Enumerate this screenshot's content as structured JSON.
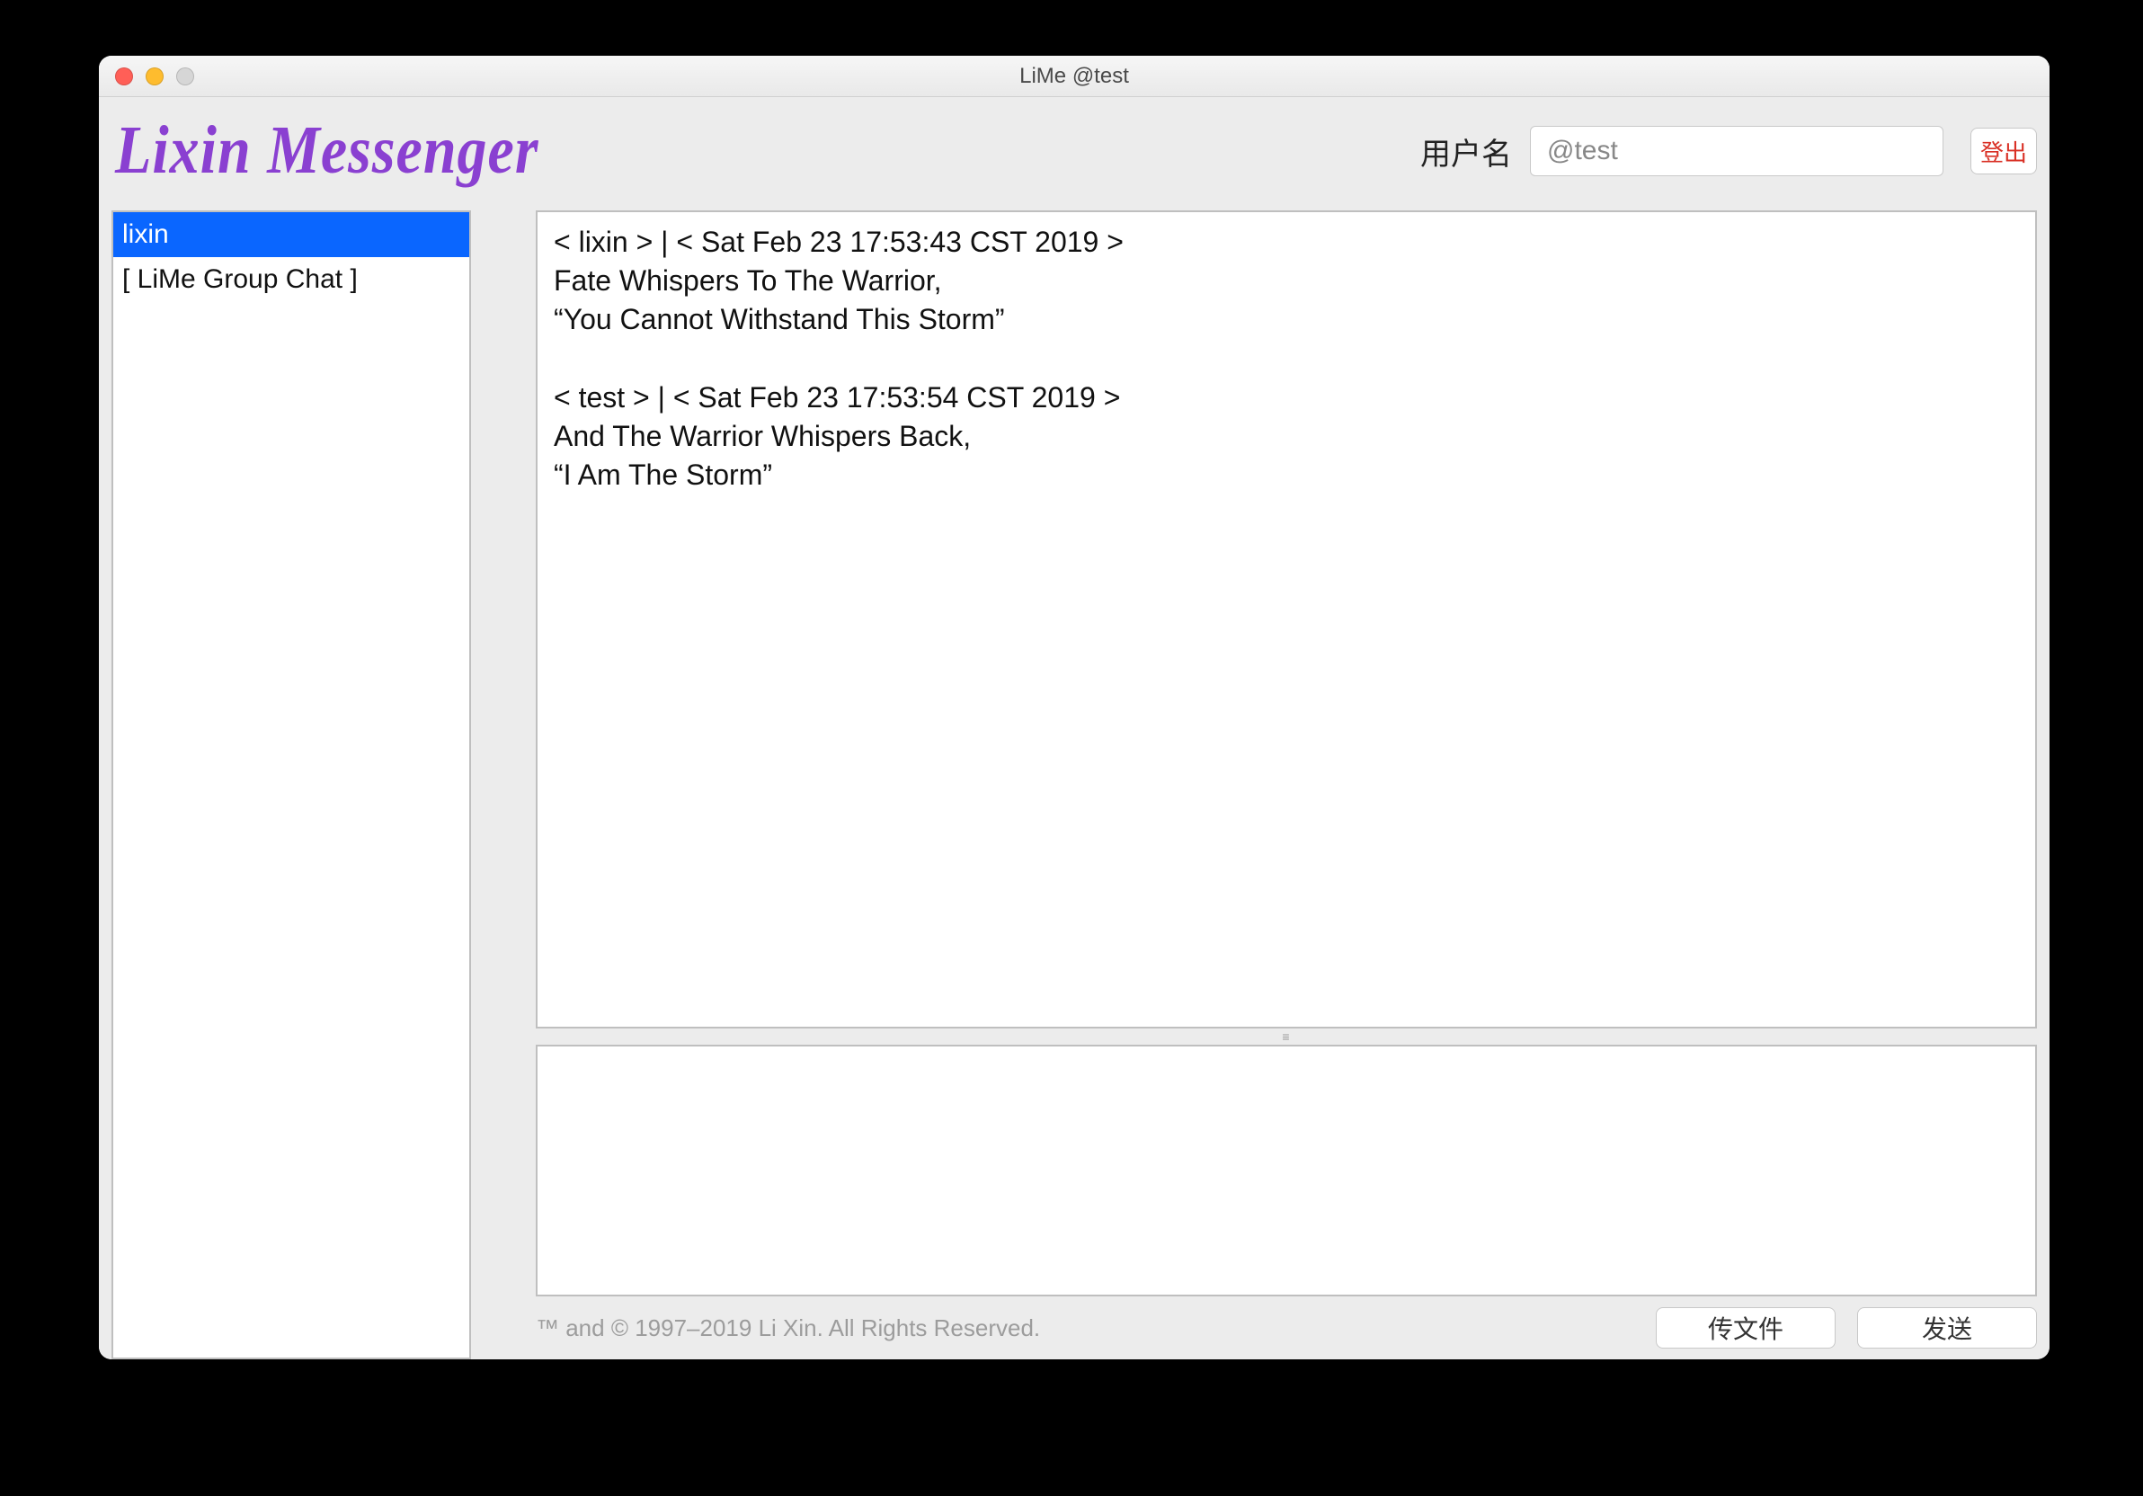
{
  "window": {
    "title": "LiMe @test"
  },
  "header": {
    "brand": "Lixin Messenger",
    "username_label": "用户名",
    "username_value": "@test",
    "logout_label": "登出"
  },
  "sidebar": {
    "contacts": [
      {
        "label": "lixin",
        "selected": true
      },
      {
        "label": "[ LiMe Group Chat ]",
        "selected": false
      }
    ]
  },
  "chat": {
    "messages": [
      {
        "sender": "lixin",
        "timestamp": "Sat Feb 23 17:53:43 CST 2019",
        "lines": [
          "Fate Whispers To The Warrior,",
          "“You Cannot Withstand This Storm”"
        ]
      },
      {
        "sender": "test",
        "timestamp": "Sat Feb 23 17:53:54 CST 2019",
        "lines": [
          "And The Warrior Whispers Back,",
          "“I Am The Storm”"
        ]
      }
    ],
    "compose_value": ""
  },
  "footer": {
    "copyright": "™ and © 1997–2019 Li Xin. All Rights Reserved.",
    "file_button": "传文件",
    "send_button": "发送"
  }
}
